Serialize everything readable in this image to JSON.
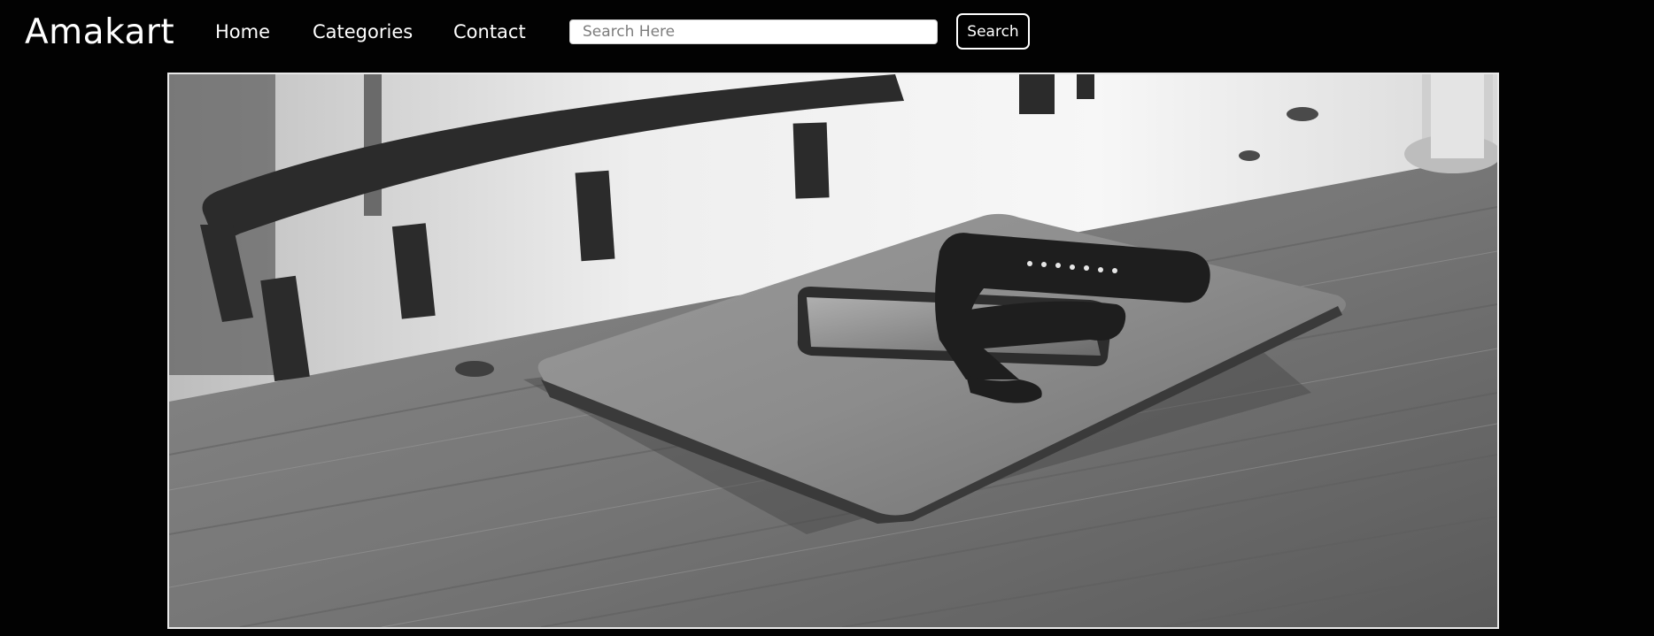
{
  "navbar": {
    "brand": "Amakart",
    "links": [
      {
        "label": "Home"
      },
      {
        "label": "Categories"
      },
      {
        "label": "Contact"
      }
    ],
    "search": {
      "placeholder": "Search Here",
      "value": "",
      "button_label": "Search"
    }
  },
  "hero": {
    "image_subject": "laptop-phone-watch-on-wooden-table-photo",
    "colors": {
      "background": "#020202",
      "text": "#ffffff"
    }
  }
}
